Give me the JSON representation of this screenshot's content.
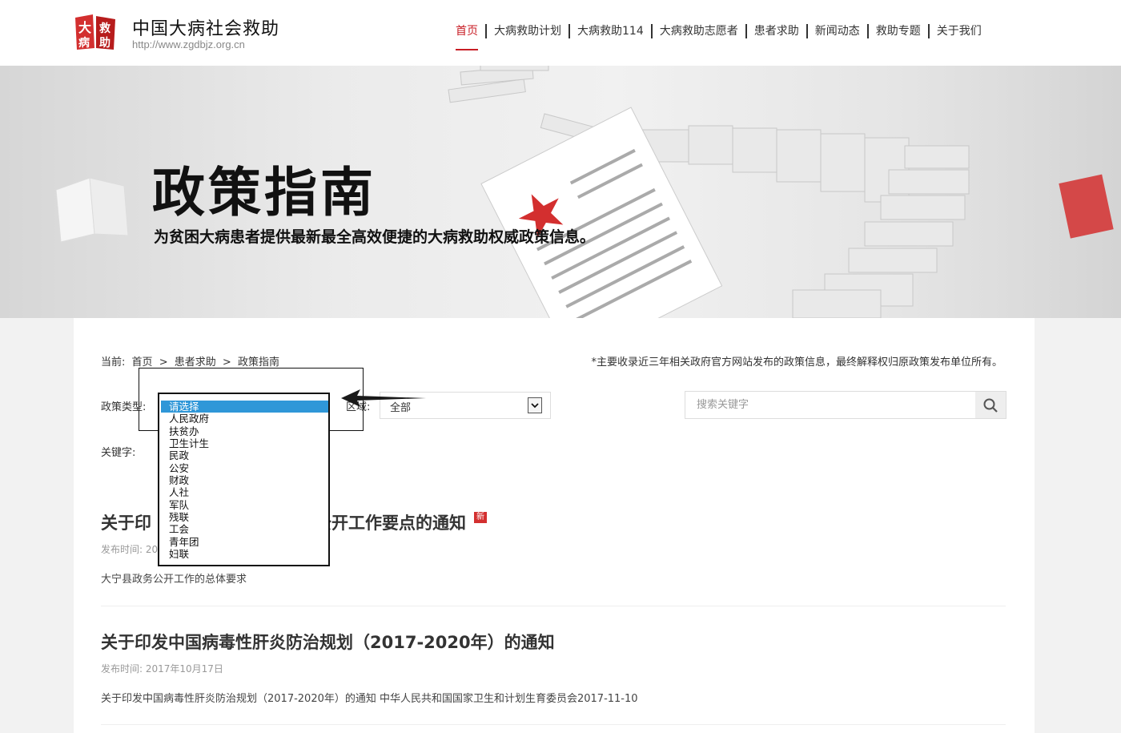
{
  "header": {
    "logo_text": "大病救助",
    "site_name": "中国大病社会救助",
    "site_url": "http://www.zgdbjz.org.cn",
    "nav": [
      {
        "label": "首页",
        "active": true
      },
      {
        "label": "大病救助计划"
      },
      {
        "label": "大病救助114"
      },
      {
        "label": "大病救助志愿者"
      },
      {
        "label": "患者求助"
      },
      {
        "label": "新闻动态"
      },
      {
        "label": "救助专题"
      },
      {
        "label": "关于我们"
      }
    ]
  },
  "banner": {
    "title": "政策指南",
    "subtitle": "为贫困大病患者提供最新最全高效便捷的大病救助权威政策信息。"
  },
  "breadcrumb": {
    "prefix": "当前:",
    "items": [
      "首页",
      "患者求助",
      "政策指南"
    ],
    "separator": ">"
  },
  "disclaimer": "*主要收录近三年相关政府官方网站发布的政策信息，最终解释权归原政策发布单位所有。",
  "filters": {
    "policy_type_label": "政策类型:",
    "region_label": "区域:",
    "region_value": "全部",
    "keyword_label": "关键字:",
    "search_placeholder": "搜索关键字"
  },
  "dropdown": {
    "options": [
      "请选择",
      "人民政府",
      "扶贫办",
      "卫生计生",
      "民政",
      "公安",
      "财政",
      "人社",
      "军队",
      "残联",
      "工会",
      "青年团",
      "妇联"
    ],
    "selected_index": 0
  },
  "articles": [
    {
      "title_visible_left": "关于印",
      "title_visible_right": "公开工作要点的通知",
      "badge": "新",
      "date_visible": "发布时间: 20",
      "summary": "大宁县政务公开工作的总体要求"
    },
    {
      "title": "关于印发中国病毒性肝炎防治规划（2017-2020年）的通知",
      "date": "发布时间: 2017年10月17日",
      "summary": "关于印发中国病毒性肝炎防治规划（2017-2020年）的通知 中华人民共和国国家卫生和计划生育委员会2017-11-10"
    }
  ],
  "colors": {
    "brand_red": "#c81d25",
    "selected_option": "#2f97d8"
  }
}
